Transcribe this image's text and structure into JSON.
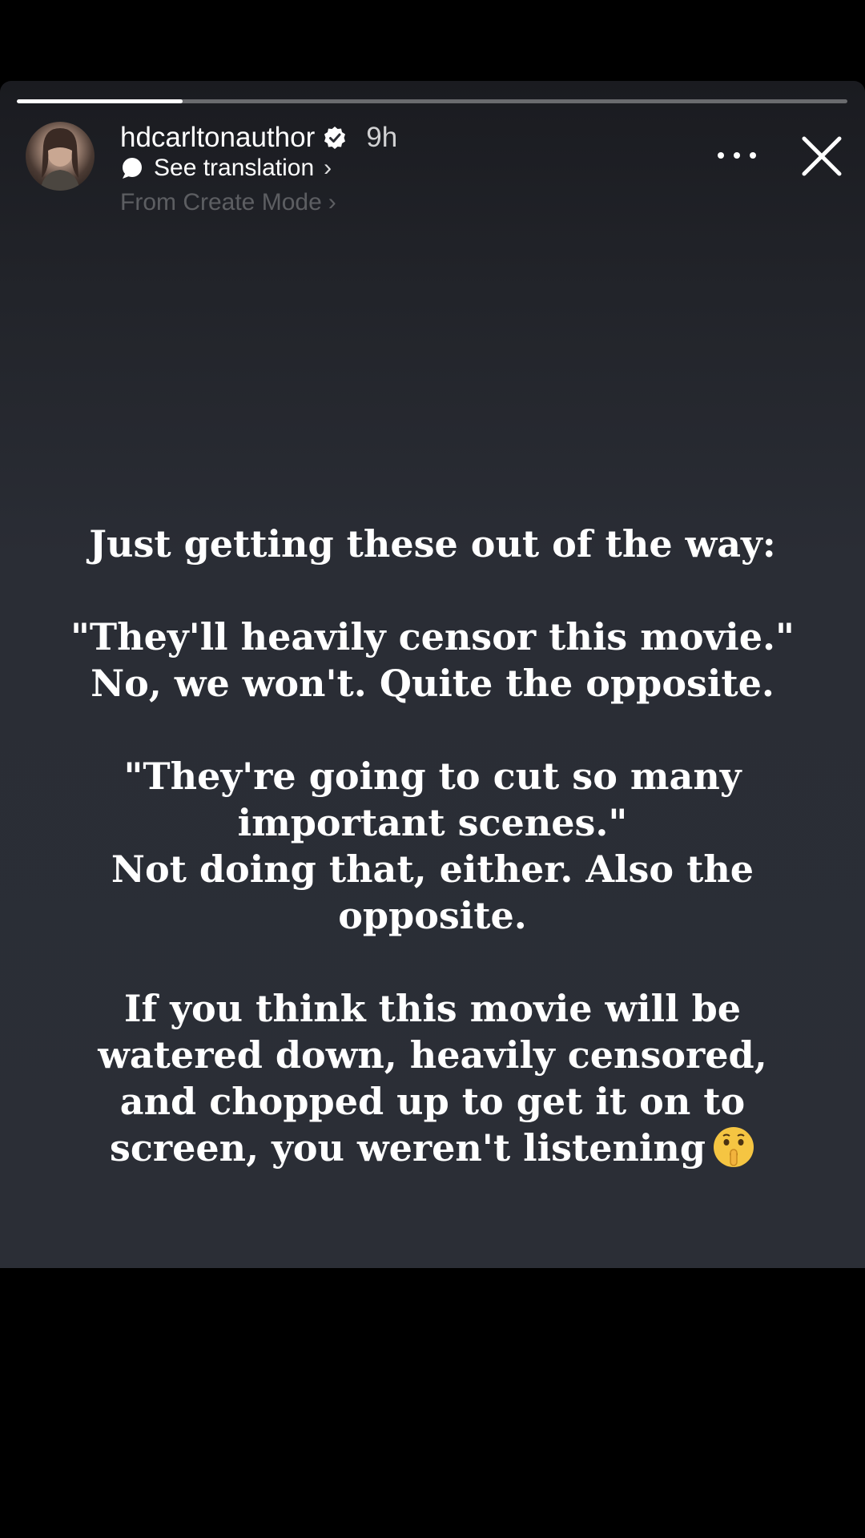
{
  "story": {
    "progress": 0.2,
    "username": "hdcarltonauthor",
    "time": "9h",
    "translation_label": "See translation",
    "create_mode_label": "From Create Mode",
    "chevron": "›"
  },
  "content": {
    "line1": "Just getting these out of the way:",
    "line2": "\"They'll heavily censor this movie.\"",
    "line3": "No, we won't. Quite the opposite.",
    "line4": "\"They're going to cut so many",
    "line5": "important scenes.\"",
    "line6": "Not doing that, either. Also the",
    "line7": "opposite.",
    "line8": "If you think this movie will be",
    "line9": "watered down, heavily censored,",
    "line10": "and chopped up to get it on to",
    "line11": "screen, you weren't listening"
  },
  "icons": {
    "verified": "verified-badge-icon",
    "translation": "speech-bubble-icon",
    "more": "more-icon",
    "close": "close-icon",
    "emoji": "shushing-face-emoji"
  },
  "colors": {
    "background": "#000000",
    "story_bg": "#2b2e36",
    "text": "#ffffff"
  }
}
